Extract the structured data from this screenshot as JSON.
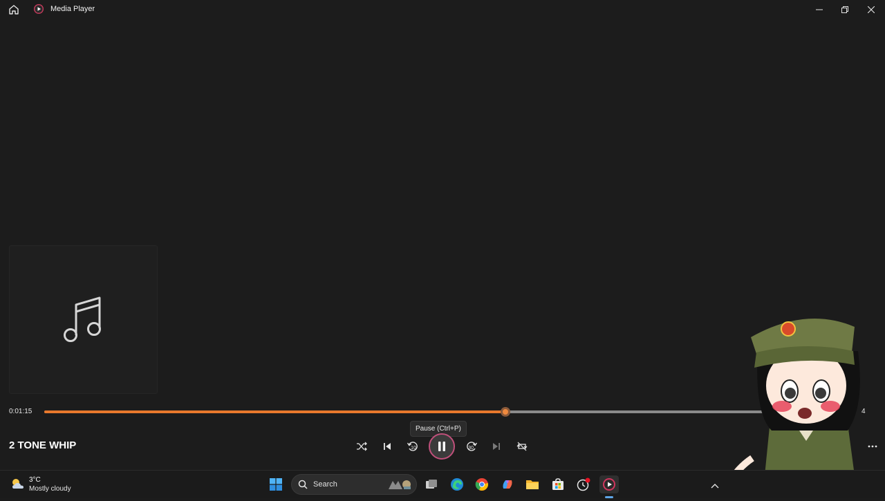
{
  "window": {
    "title": "Media Player",
    "icons": {
      "home": "home-icon",
      "app": "media-player-icon",
      "minimize": "minimize-icon",
      "maximize": "maximize-icon",
      "close": "close-icon"
    }
  },
  "album_art": {
    "icon": "music-note-icon"
  },
  "playback": {
    "current_time": "0:01:15",
    "total_time": "4",
    "progress": 0.568,
    "song_title": "2 TONE WHIP",
    "tooltip": "Pause (Ctrl+P)",
    "accent_color": "#e8782c",
    "controls": [
      "shuffle-icon",
      "previous-icon",
      "skip-back-10-icon",
      "pause-icon",
      "skip-forward-30-icon",
      "next-icon",
      "repeat-icon"
    ],
    "skip_back_label": "10",
    "skip_forward_label": "30"
  },
  "taskbar": {
    "weather": {
      "temp": "3°C",
      "desc": "Mostly cloudy"
    },
    "search_label": "Search",
    "apps": [
      "windows-start-icon",
      "task-view-icon",
      "edge-icon",
      "chrome-icon",
      "copilot-icon",
      "file-explorer-icon",
      "microsoft-store-icon",
      "clock-app-icon",
      "media-player-icon"
    ]
  }
}
